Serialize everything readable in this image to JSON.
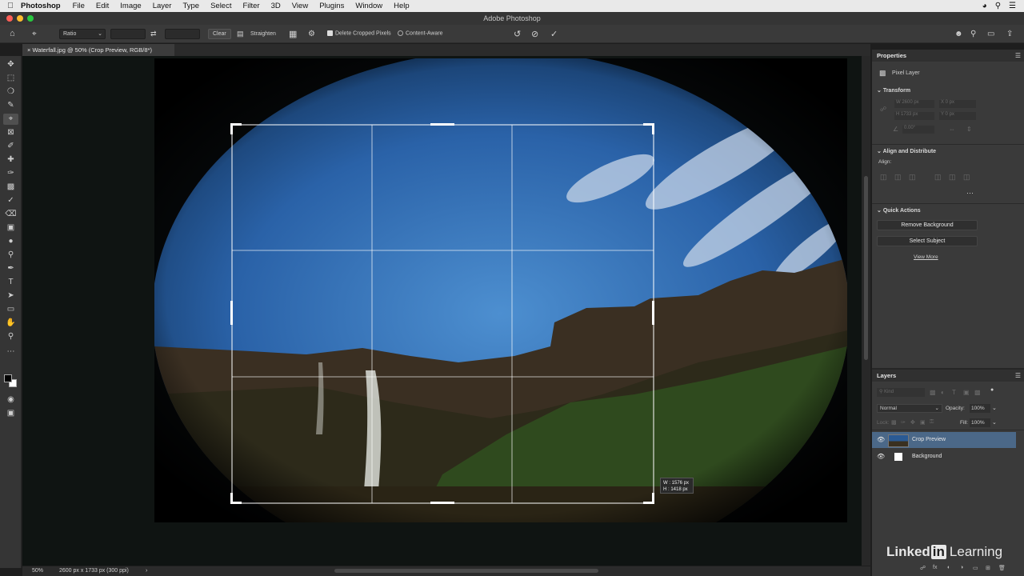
{
  "menubar": {
    "app": "Photoshop",
    "items": [
      "File",
      "Edit",
      "Image",
      "Layer",
      "Type",
      "Select",
      "Filter",
      "3D",
      "View",
      "Plugins",
      "Window",
      "Help"
    ]
  },
  "window": {
    "title": "Adobe Photoshop"
  },
  "options": {
    "ratio": "Ratio",
    "clear": "Clear",
    "straighten": "Straighten",
    "delete_cropped": "Delete Cropped Pixels",
    "content_aware": "Content-Aware"
  },
  "document": {
    "tab": "Waterfall.jpg @ 50% (Crop Preview, RGB/8*)",
    "zoom": "50%",
    "info": "2600 px x 1733 px (300 ppi)"
  },
  "crop": {
    "readout_w": "W : 1576 px",
    "readout_h": "H : 1418 px"
  },
  "properties": {
    "tab": "Properties",
    "kind": "Pixel Layer",
    "transform": "Transform",
    "w": "W  2600 px",
    "h": "H  1733 px",
    "x": "X  0 px",
    "y": "Y  0 px",
    "angle": "0.00°",
    "align_distribute": "Align and Distribute",
    "align": "Align:",
    "quick_actions": "Quick Actions",
    "remove_bg": "Remove Background",
    "select_subject": "Select Subject",
    "view_more": "View More"
  },
  "layers": {
    "tab": "Layers",
    "kind": "Kind",
    "blend": "Normal",
    "opacity_label": "Opacity:",
    "opacity": "100%",
    "lock": "Lock:",
    "fill_label": "Fill:",
    "fill": "100%",
    "items": [
      {
        "name": "Crop Preview"
      },
      {
        "name": "Background"
      }
    ]
  },
  "watermark": {
    "brand": "Linked",
    "in": "in",
    "learning": "Learning"
  }
}
